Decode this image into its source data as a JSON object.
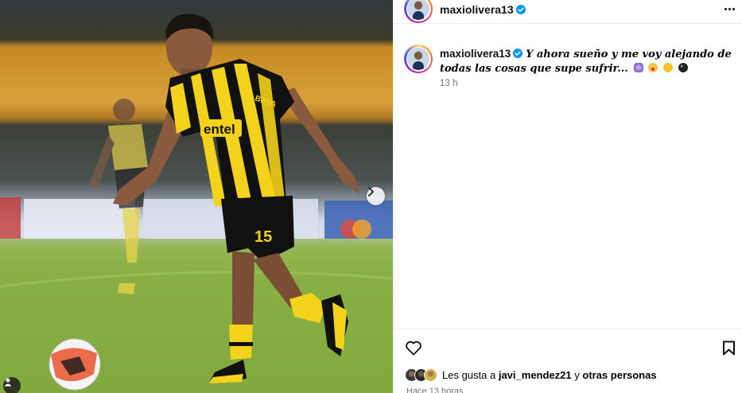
{
  "post": {
    "username": "maxiolivera13",
    "caption": "Y ahora sueño y me voy alejando de todas las cosas que supe sufrir...",
    "caption_emojis": [
      "dizzy-emoji",
      "heart-eyes-emoji",
      "yellow-circle-emoji",
      "black-circle-emoji"
    ],
    "time": "13 h",
    "likes_prefix": "Les gusta a",
    "likes_user": "javi_mendez21",
    "likes_joiner": "y",
    "likes_suffix": "otras personas",
    "posted_ago": "Hace 13 horas"
  },
  "photo": {
    "jersey_sponsor": "entel",
    "jersey_number": "15",
    "sleeve_sponsor": "BBVA"
  },
  "colors": {
    "verified": "#0095f6",
    "jersey_yellow": "#f2d21b",
    "jersey_black": "#111111",
    "secondary_text": "#737373"
  },
  "icons": {
    "next": "chevron-right-icon",
    "tag": "user-tag-icon",
    "like": "heart-outline-icon",
    "save": "bookmark-icon",
    "more": "more-options-icon",
    "verified": "verified-badge-icon"
  }
}
